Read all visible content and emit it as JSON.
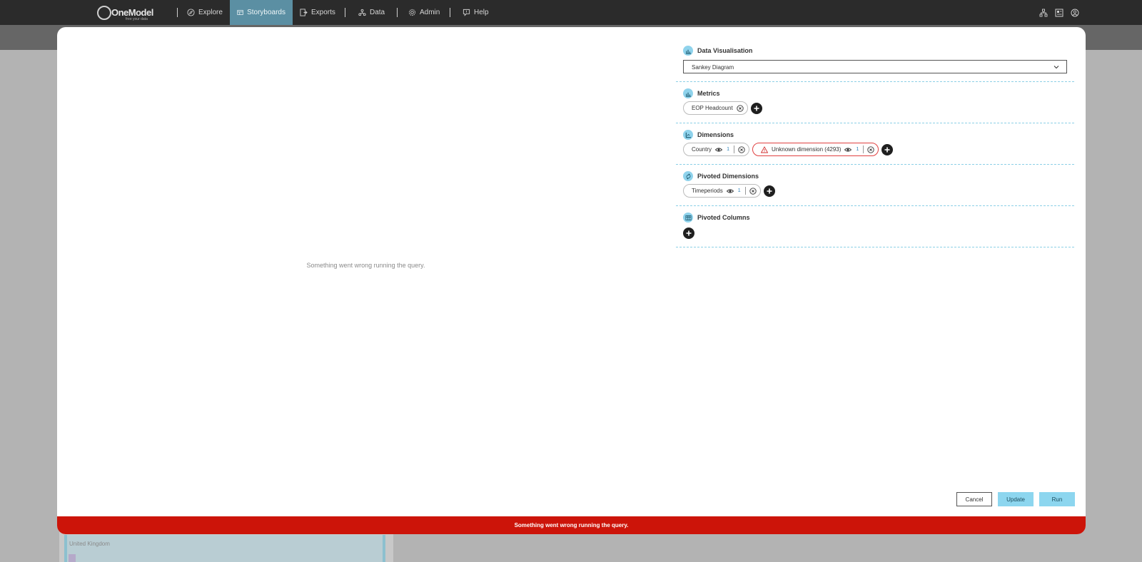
{
  "app": {
    "logo_name": "OneModel",
    "logo_tagline": "free your data"
  },
  "nav": {
    "items": [
      {
        "label": "Explore",
        "icon": "compass-icon",
        "active": false
      },
      {
        "label": "Storyboards",
        "icon": "storyboard-icon",
        "active": true
      },
      {
        "label": "Exports",
        "icon": "export-icon",
        "active": false
      },
      {
        "label": "Data",
        "icon": "data-icon",
        "active": false
      },
      {
        "label": "Admin",
        "icon": "gear-icon",
        "active": false
      },
      {
        "label": "Help",
        "icon": "help-icon",
        "active": false
      }
    ],
    "right_icons": [
      "org-chart-icon",
      "dashboard-icon",
      "user-icon"
    ]
  },
  "background": {
    "card_label": "United Kingdom"
  },
  "preview": {
    "message": "Something went wrong running the query."
  },
  "config": {
    "data_visualisation": {
      "title": "Data Visualisation",
      "selected": "Sankey Diagram"
    },
    "metrics": {
      "title": "Metrics",
      "chips": [
        {
          "label": "EOP Headcount"
        }
      ]
    },
    "dimensions": {
      "title": "Dimensions",
      "chips": [
        {
          "label": "Country",
          "level": "1",
          "error": false
        },
        {
          "label": "Unknown dimension (4293)",
          "level": "1",
          "error": true
        }
      ]
    },
    "pivoted_dimensions": {
      "title": "Pivoted Dimensions",
      "chips": [
        {
          "label": "Timeperiods",
          "level": "1"
        }
      ]
    },
    "pivoted_columns": {
      "title": "Pivoted Columns"
    }
  },
  "actions": {
    "cancel": "Cancel",
    "update": "Update",
    "run": "Run"
  },
  "error_banner": "Something went wrong running the query.",
  "colors": {
    "accent": "#8dd6ef",
    "nav_active": "#5b8fa3",
    "error": "#cc1409"
  }
}
